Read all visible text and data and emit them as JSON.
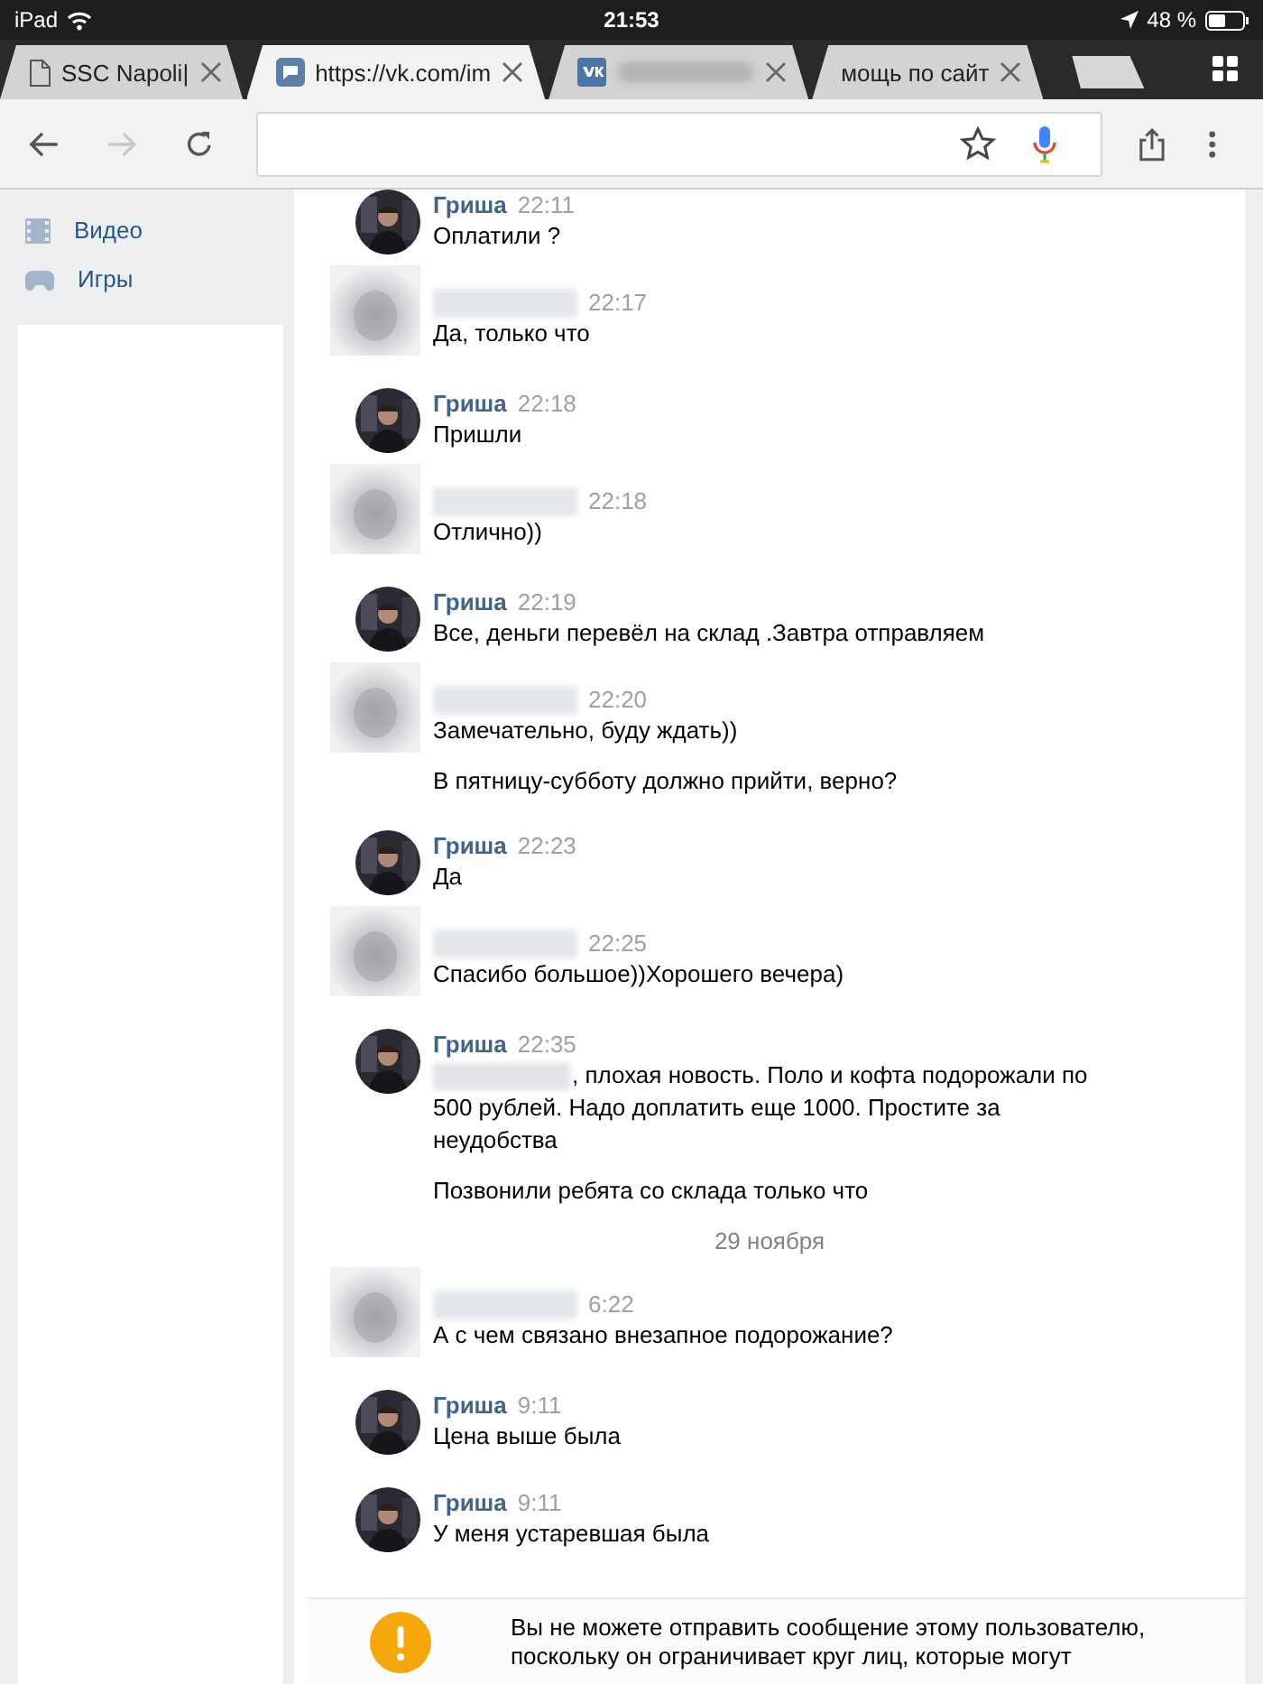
{
  "status_bar": {
    "device": "iPad",
    "time": "21:53",
    "battery": "48 %"
  },
  "tabs": [
    {
      "title": "SSC Napoli|",
      "kind": "page",
      "selected": false
    },
    {
      "title": "https://vk.com/im",
      "kind": "chat",
      "selected": true
    },
    {
      "title_hidden": true,
      "kind": "site",
      "selected": false
    },
    {
      "title": "мощь по сайт",
      "kind": "plain",
      "selected": false
    }
  ],
  "toolbar": {
    "forward_disabled": true
  },
  "sidebar": {
    "items": [
      {
        "label": "Видео",
        "kind": "film"
      },
      {
        "label": "Игры",
        "kind": "gamepad"
      }
    ]
  },
  "messages": [
    {
      "kind": "own",
      "name": "Гриша",
      "time": "22:11",
      "paragraphs": [
        {
          "text": "Оплатили ?"
        }
      ]
    },
    {
      "kind": "other",
      "time": "22:17",
      "paragraphs": [
        {
          "text": "Да, только что"
        }
      ]
    },
    {
      "kind": "own",
      "name": "Гриша",
      "time": "22:18",
      "paragraphs": [
        {
          "text": "Пришли"
        }
      ]
    },
    {
      "kind": "other",
      "time": "22:18",
      "paragraphs": [
        {
          "text": "Отлично))"
        }
      ]
    },
    {
      "kind": "own",
      "name": "Гриша",
      "time": "22:19",
      "paragraphs": [
        {
          "text": "Все, деньги перевёл на склад .Завтра отправляем"
        }
      ]
    },
    {
      "kind": "other",
      "time": "22:20",
      "paragraphs": [
        {
          "text": "Замечательно, буду ждать))"
        },
        {
          "text": "В пятницу-субботу должно прийти, верно?"
        }
      ]
    },
    {
      "kind": "own",
      "name": "Гриша",
      "time": "22:23",
      "paragraphs": [
        {
          "text": "Да"
        }
      ]
    },
    {
      "kind": "other",
      "time": "22:25",
      "paragraphs": [
        {
          "text": "Спасибо большое))Хорошего вечера)"
        }
      ]
    },
    {
      "kind": "own",
      "name": "Гриша",
      "time": "22:35",
      "paragraphs": [
        {
          "text": ", плохая новость. Поло и кофта подорожали по",
          "redacted_prefix": true,
          "continuation": "500 рублей. Надо доплатить еще 1000. Простите за неудобства"
        },
        {
          "text": "Позвонили ребята со склада только что"
        }
      ]
    },
    {
      "kind": "date",
      "text": "29 ноября"
    },
    {
      "kind": "other",
      "time": "6:22",
      "paragraphs": [
        {
          "text": "А с чем связано внезапное подорожание?"
        }
      ]
    },
    {
      "kind": "own",
      "name": "Гриша",
      "time": "9:11",
      "paragraphs": [
        {
          "text": "Цена выше была"
        }
      ]
    },
    {
      "kind": "own",
      "name": "Гриша",
      "time": "9:11",
      "paragraphs": [
        {
          "text": "У меня устаревшая была"
        }
      ]
    }
  ],
  "notice": {
    "text": "Вы не можете отправить сообщение этому пользователю, поскольку он ограничивает круг лиц, которые могут"
  }
}
